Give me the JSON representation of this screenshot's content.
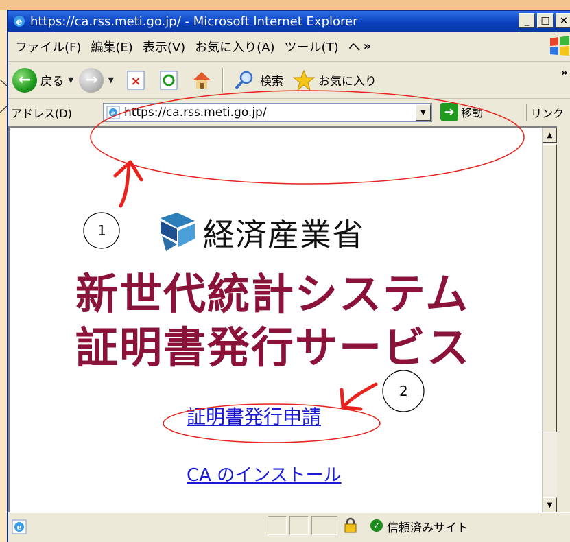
{
  "window": {
    "title": "https://ca.rss.meti.go.jp/ - Microsoft Internet Explorer",
    "buttons": {
      "minimize": "_",
      "maximize": "□",
      "close": "×"
    }
  },
  "menubar": {
    "items": [
      "ファイル(F)",
      "編集(E)",
      "表示(V)",
      "お気に入り(A)",
      "ツール(T)",
      "ヘ"
    ]
  },
  "toolbar": {
    "back_label": "戻る",
    "search_label": "検索",
    "favorites_label": "お気に入り",
    "more": "»"
  },
  "address": {
    "label": "アドレス(D)",
    "value": "https://ca.rss.meti.go.jp/",
    "go_label": "移動",
    "links_label": "リンク"
  },
  "page": {
    "logo_text": "経済産業省",
    "heading_line1": "新世代統計システム",
    "heading_line2": "証明書発行サービス",
    "link_apply": "証明書発行申請",
    "link_install": "CA のインストール"
  },
  "status": {
    "zone": "信頼済みサイト"
  },
  "annotations": {
    "marker1": "1",
    "marker2": "2",
    "color": "#e8231e"
  },
  "colors": {
    "heading": "#8b1238",
    "link": "#1a1ad6",
    "titlebar": "#0a3fbd"
  }
}
